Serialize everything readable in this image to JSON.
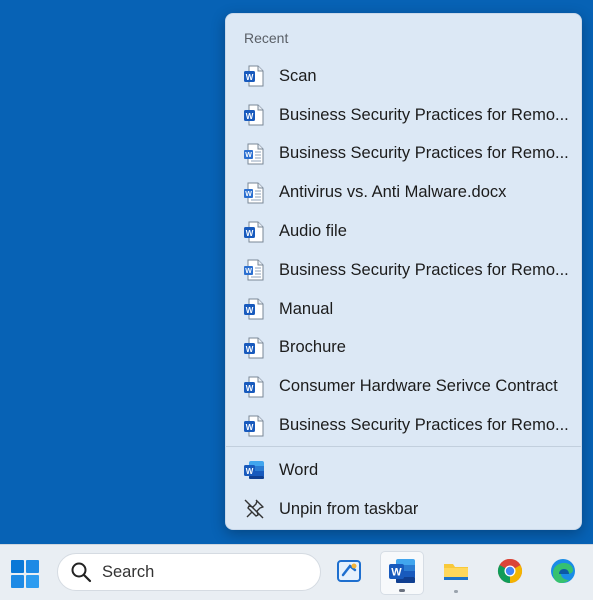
{
  "jumplist": {
    "section_label": "Recent",
    "recent_items": [
      {
        "label": "Scan",
        "icon": "word-doc-icon"
      },
      {
        "label": "Business Security Practices for Remo...",
        "icon": "word-doc-icon"
      },
      {
        "label": "Business Security Practices for Remo...",
        "icon": "word-doc-plain-icon"
      },
      {
        "label": "Antivirus vs. Anti Malware.docx",
        "icon": "word-doc-plain-icon"
      },
      {
        "label": "Audio file",
        "icon": "word-doc-icon"
      },
      {
        "label": "Business Security Practices for Remo...",
        "icon": "word-doc-plain-icon"
      },
      {
        "label": "Manual",
        "icon": "word-doc-icon"
      },
      {
        "label": "Brochure",
        "icon": "word-doc-icon"
      },
      {
        "label": "Consumer Hardware Serivce Contract",
        "icon": "word-doc-icon"
      },
      {
        "label": "Business Security Practices for Remo...",
        "icon": "word-doc-icon"
      }
    ],
    "tasks": [
      {
        "label": "Word",
        "icon": "word-app-icon"
      },
      {
        "label": "Unpin from taskbar",
        "icon": "unpin-icon"
      }
    ]
  },
  "taskbar": {
    "search_label": "Search",
    "apps": [
      "snipping-tool-icon",
      "word-app-icon",
      "file-explorer-icon",
      "chrome-icon",
      "edge-icon"
    ],
    "active_app": "word-app-icon"
  },
  "colors": {
    "desktop": "#0762b5",
    "word_blue": "#185abd",
    "jumplist_bg": "#dce8f5",
    "taskbar_bg": "#e9eef3"
  }
}
